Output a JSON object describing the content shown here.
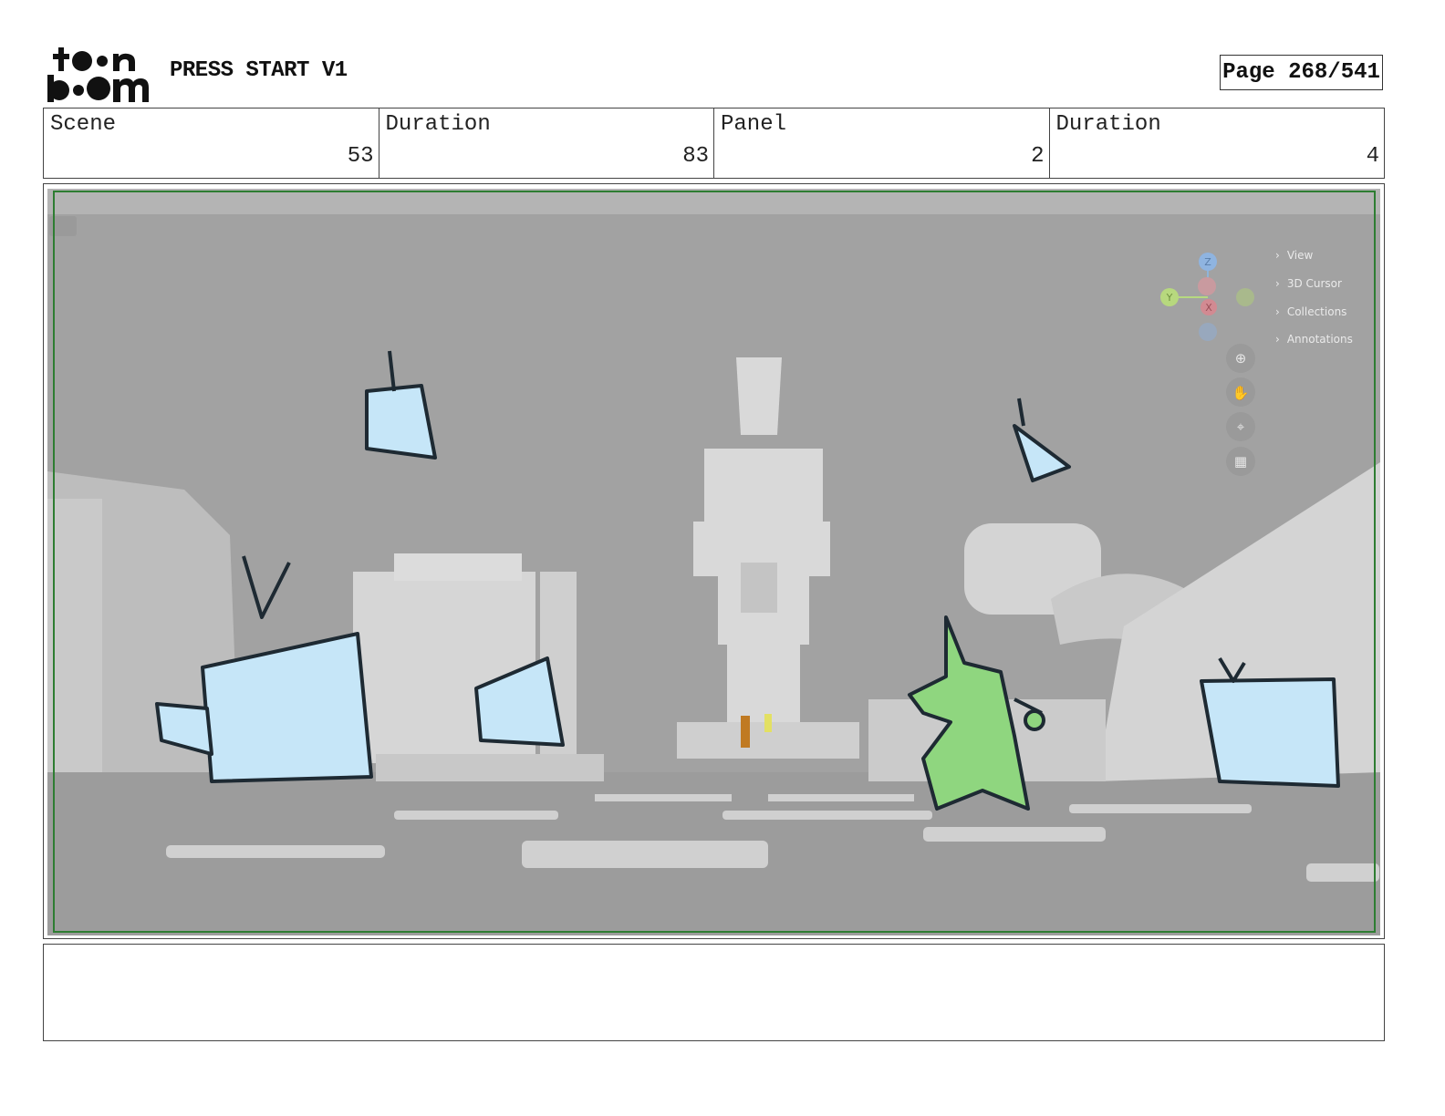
{
  "header": {
    "logo_text": "toon boom",
    "project_title": "PRESS START V1",
    "page_label": "Page 268/541"
  },
  "info": {
    "scene_label": "Scene",
    "scene_value": "53",
    "scene_duration_label": "Duration",
    "scene_duration_value": "83",
    "panel_label": "Panel",
    "panel_value": "2",
    "panel_duration_label": "Duration",
    "panel_duration_value": "4"
  },
  "viewport_overlay": {
    "axes": {
      "z": "Z",
      "y": "Y",
      "x": "X"
    },
    "menu": [
      "View",
      "3D Cursor",
      "Collections",
      "Annotations"
    ],
    "tools": [
      "zoom-icon",
      "hand-icon",
      "camera-icon",
      "grid-icon"
    ]
  },
  "colors": {
    "frame_green": "#2e7d32",
    "sketch_blue": "#c6e6f8",
    "sketch_green": "#8fd67f",
    "viewport_gray": "#a2a2a2"
  },
  "notes": ""
}
